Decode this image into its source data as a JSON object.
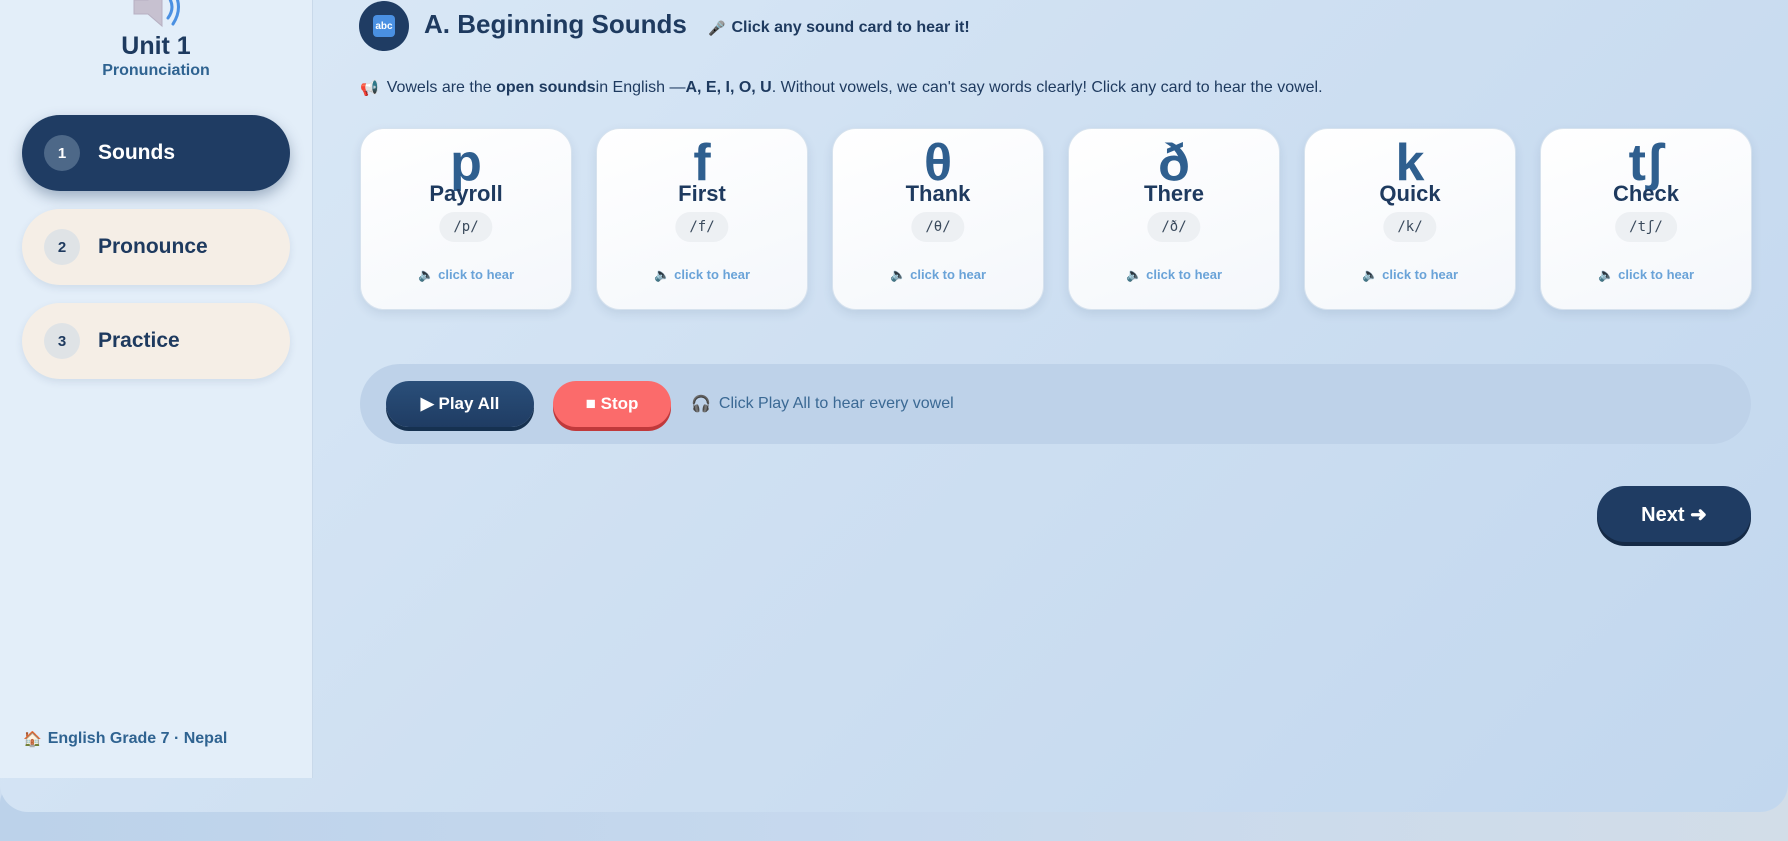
{
  "sidebar": {
    "unit_title": "Unit 1",
    "unit_subtitle": "Pronunciation",
    "items": [
      {
        "number": "1",
        "label": "Sounds",
        "active": true
      },
      {
        "number": "2",
        "label": "Pronounce",
        "active": false
      },
      {
        "number": "3",
        "label": "Practice",
        "active": false
      }
    ],
    "footer_icon": "house-icon",
    "footer": "English Grade 7 · Nepal"
  },
  "header": {
    "badge_icon": "abc-icon",
    "badge_text": "abc",
    "title": "A. Beginning Sounds",
    "hint_icon": "microphone-icon",
    "hint": "Click any sound card to hear it!"
  },
  "intro": {
    "icon": "megaphone-icon",
    "prefix": "Vowels are the ",
    "bold1": "open sounds",
    "middle": " in English — ",
    "bold2": "A, E, I, O, U",
    "suffix": ". Without vowels, we can't say words clearly! Click any card to hear the vowel."
  },
  "cards": [
    {
      "symbol": "p",
      "word": "Payroll",
      "ipa": "/p/",
      "hear": "click to hear"
    },
    {
      "symbol": "f",
      "word": "First",
      "ipa": "/f/",
      "hear": "click to hear"
    },
    {
      "symbol": "θ",
      "word": "Thank",
      "ipa": "/θ/",
      "hear": "click to hear"
    },
    {
      "symbol": "ð",
      "word": "There",
      "ipa": "/ð/",
      "hear": "click to hear"
    },
    {
      "symbol": "k",
      "word": "Quick",
      "ipa": "/k/",
      "hear": "click to hear"
    },
    {
      "symbol": "tʃ",
      "word": "Check",
      "ipa": "/tʃ/",
      "hear": "click to hear"
    }
  ],
  "controls": {
    "play_all": "▶ Play All",
    "stop": "■ Stop",
    "hint_icon": "headphones-icon",
    "hint": "Click Play All to hear every vowel"
  },
  "next_button": "Next ➜",
  "colors": {
    "primary": "#1f3c63",
    "accent_blue": "#2f6391",
    "stop_red": "#fb6b6b",
    "nav_inactive": "#f5eee6",
    "link_blue": "#6aa3d8"
  }
}
